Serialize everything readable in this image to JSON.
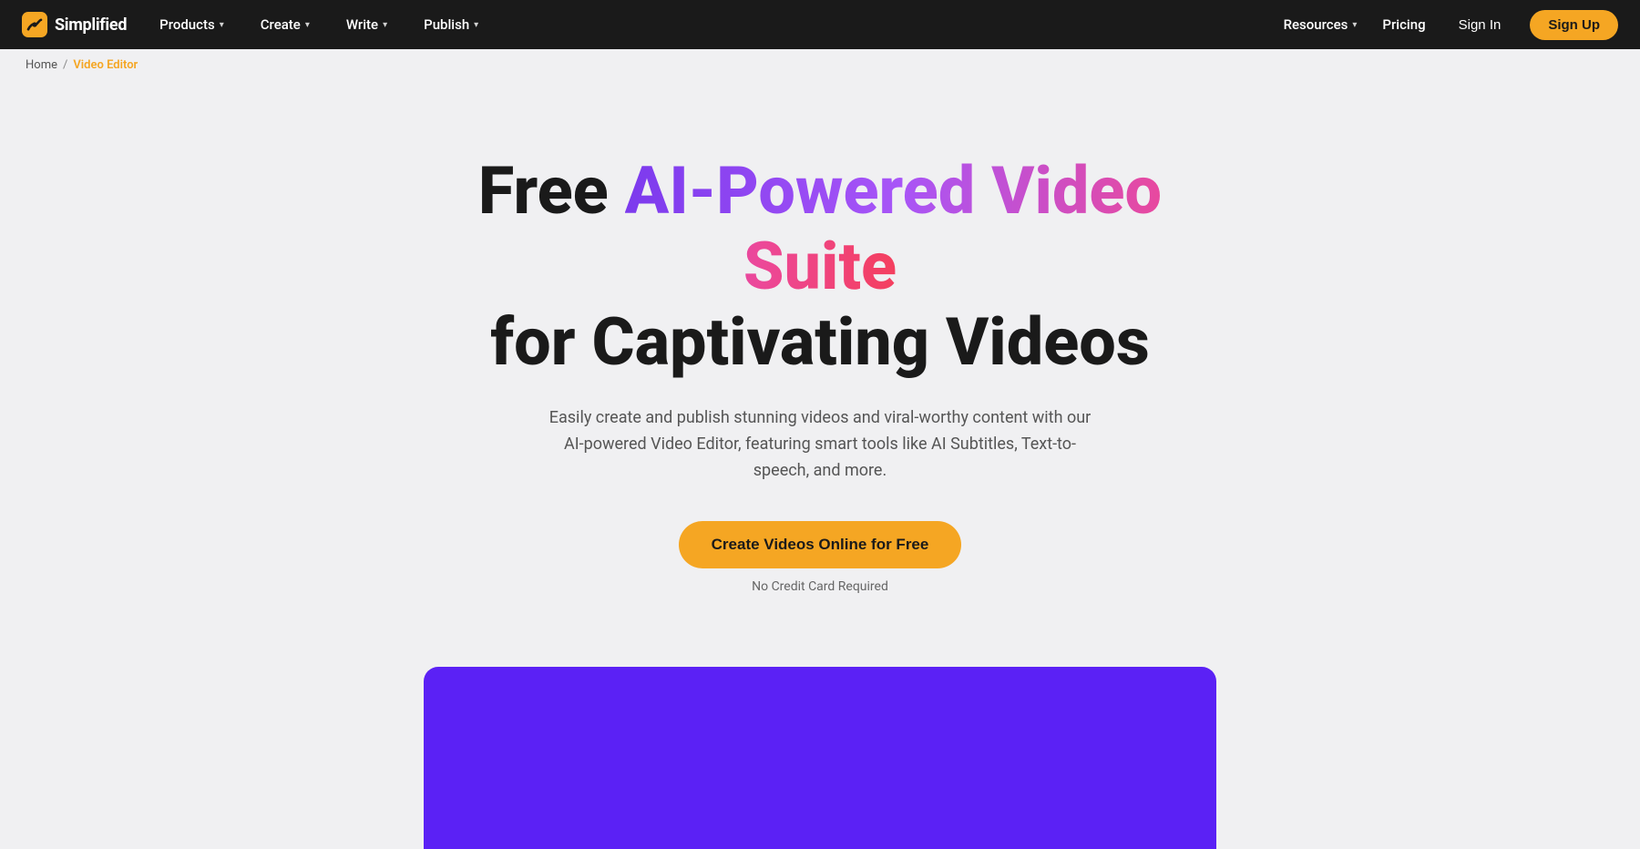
{
  "brand": {
    "name": "Simplified",
    "logo_alt": "Simplified Logo"
  },
  "navbar": {
    "items": [
      {
        "label": "Products",
        "has_dropdown": true
      },
      {
        "label": "Create",
        "has_dropdown": true
      },
      {
        "label": "Write",
        "has_dropdown": true
      },
      {
        "label": "Publish",
        "has_dropdown": true
      }
    ],
    "right_items": [
      {
        "label": "Resources",
        "has_dropdown": true
      },
      {
        "label": "Pricing",
        "has_dropdown": false
      }
    ],
    "signin_label": "Sign In",
    "signup_label": "Sign Up"
  },
  "breadcrumb": {
    "home": "Home",
    "separator": "/",
    "current": "Video Editor"
  },
  "hero": {
    "title_plain": "Free ",
    "title_gradient": "AI-Powered Video Suite",
    "title_plain2": "for Captivating Videos",
    "subtitle": "Easily create and publish stunning videos and viral-worthy content with our AI-powered Video Editor, featuring smart tools like AI Subtitles, Text-to-speech, and more.",
    "cta_button": "Create Videos Online for Free",
    "no_cc": "No Credit Card Required"
  },
  "colors": {
    "accent_yellow": "#f5a623",
    "accent_gradient_start": "#7c3aed",
    "accent_gradient_end": "#f43f5e",
    "video_preview_bg": "#5b21f5",
    "navbar_bg": "#1a1a1a"
  }
}
